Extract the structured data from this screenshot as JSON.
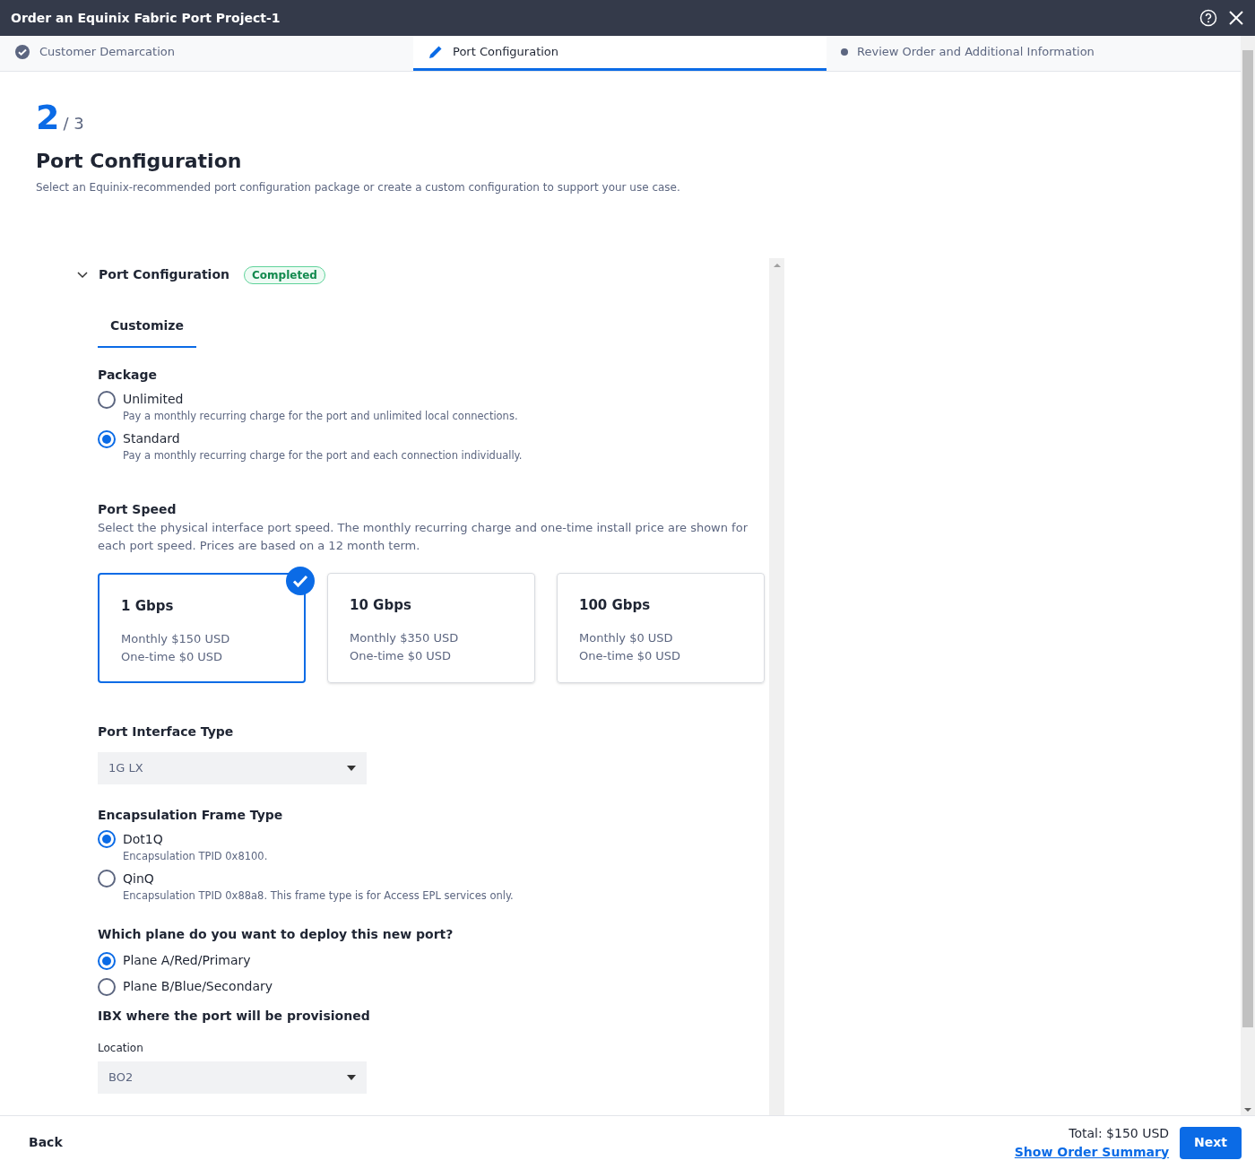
{
  "window": {
    "title": "Order an Equinix Fabric Port Project-1"
  },
  "steps": [
    {
      "label": "Customer Demarcation",
      "kind": "done",
      "selected": false
    },
    {
      "label": "Port Configuration",
      "kind": "active",
      "selected": true
    },
    {
      "label": "Review Order and Additional Information",
      "kind": "pending",
      "selected": false
    }
  ],
  "page": {
    "step": "2",
    "total": "/ 3",
    "title": "Port Configuration",
    "subtitle": "Select an Equinix-recommended port configuration package or create a custom configuration to support your use case."
  },
  "section": {
    "title": "Port Configuration",
    "expanded": true,
    "badge": "Completed"
  },
  "tabs": [
    {
      "label": "Customize",
      "selected": true
    }
  ],
  "package": {
    "label": "Package",
    "options": [
      {
        "label": "Unlimited",
        "description": "Pay a monthly recurring charge for the port and unlimited local connections.",
        "selected": false
      },
      {
        "label": "Standard",
        "description": "Pay a monthly recurring charge for the port and each connection individually.",
        "selected": true
      }
    ]
  },
  "port_speed": {
    "label": "Port Speed",
    "description": "Select the physical interface port speed. The monthly recurring charge and one-time install price are shown for each port speed. Prices are based on a 12 month term.",
    "options": [
      {
        "title": "1 Gbps",
        "monthly": "Monthly $150 USD",
        "one_time": "One-time $0 USD",
        "selected": true
      },
      {
        "title": "10 Gbps",
        "monthly": "Monthly $350 USD",
        "one_time": "One-time $0 USD",
        "selected": false
      },
      {
        "title": "100 Gbps",
        "monthly": "Monthly $0 USD",
        "one_time": "One-time $0 USD",
        "selected": false
      }
    ]
  },
  "interface_type": {
    "label": "Port Interface Type",
    "value": "1G LX"
  },
  "encapsulation": {
    "label": "Encapsulation Frame Type",
    "options": [
      {
        "label": "Dot1Q",
        "description": "Encapsulation TPID 0x8100.",
        "selected": true
      },
      {
        "label": "QinQ",
        "description": "Encapsulation TPID 0x88a8. This frame type is for Access EPL services only.",
        "selected": false
      }
    ]
  },
  "plane": {
    "label": "Which plane do you want to deploy this new port?",
    "options": [
      {
        "label": "Plane A/Red/Primary",
        "selected": true
      },
      {
        "label": "Plane B/Blue/Secondary",
        "selected": false
      }
    ]
  },
  "ibx": {
    "label": "IBX where the port will be provisioned",
    "field_label": "Location",
    "value": "BO2"
  },
  "footer": {
    "back": "Back",
    "total": "Total: $150 USD",
    "summary_link": "Show Order Summary",
    "next": "Next"
  }
}
